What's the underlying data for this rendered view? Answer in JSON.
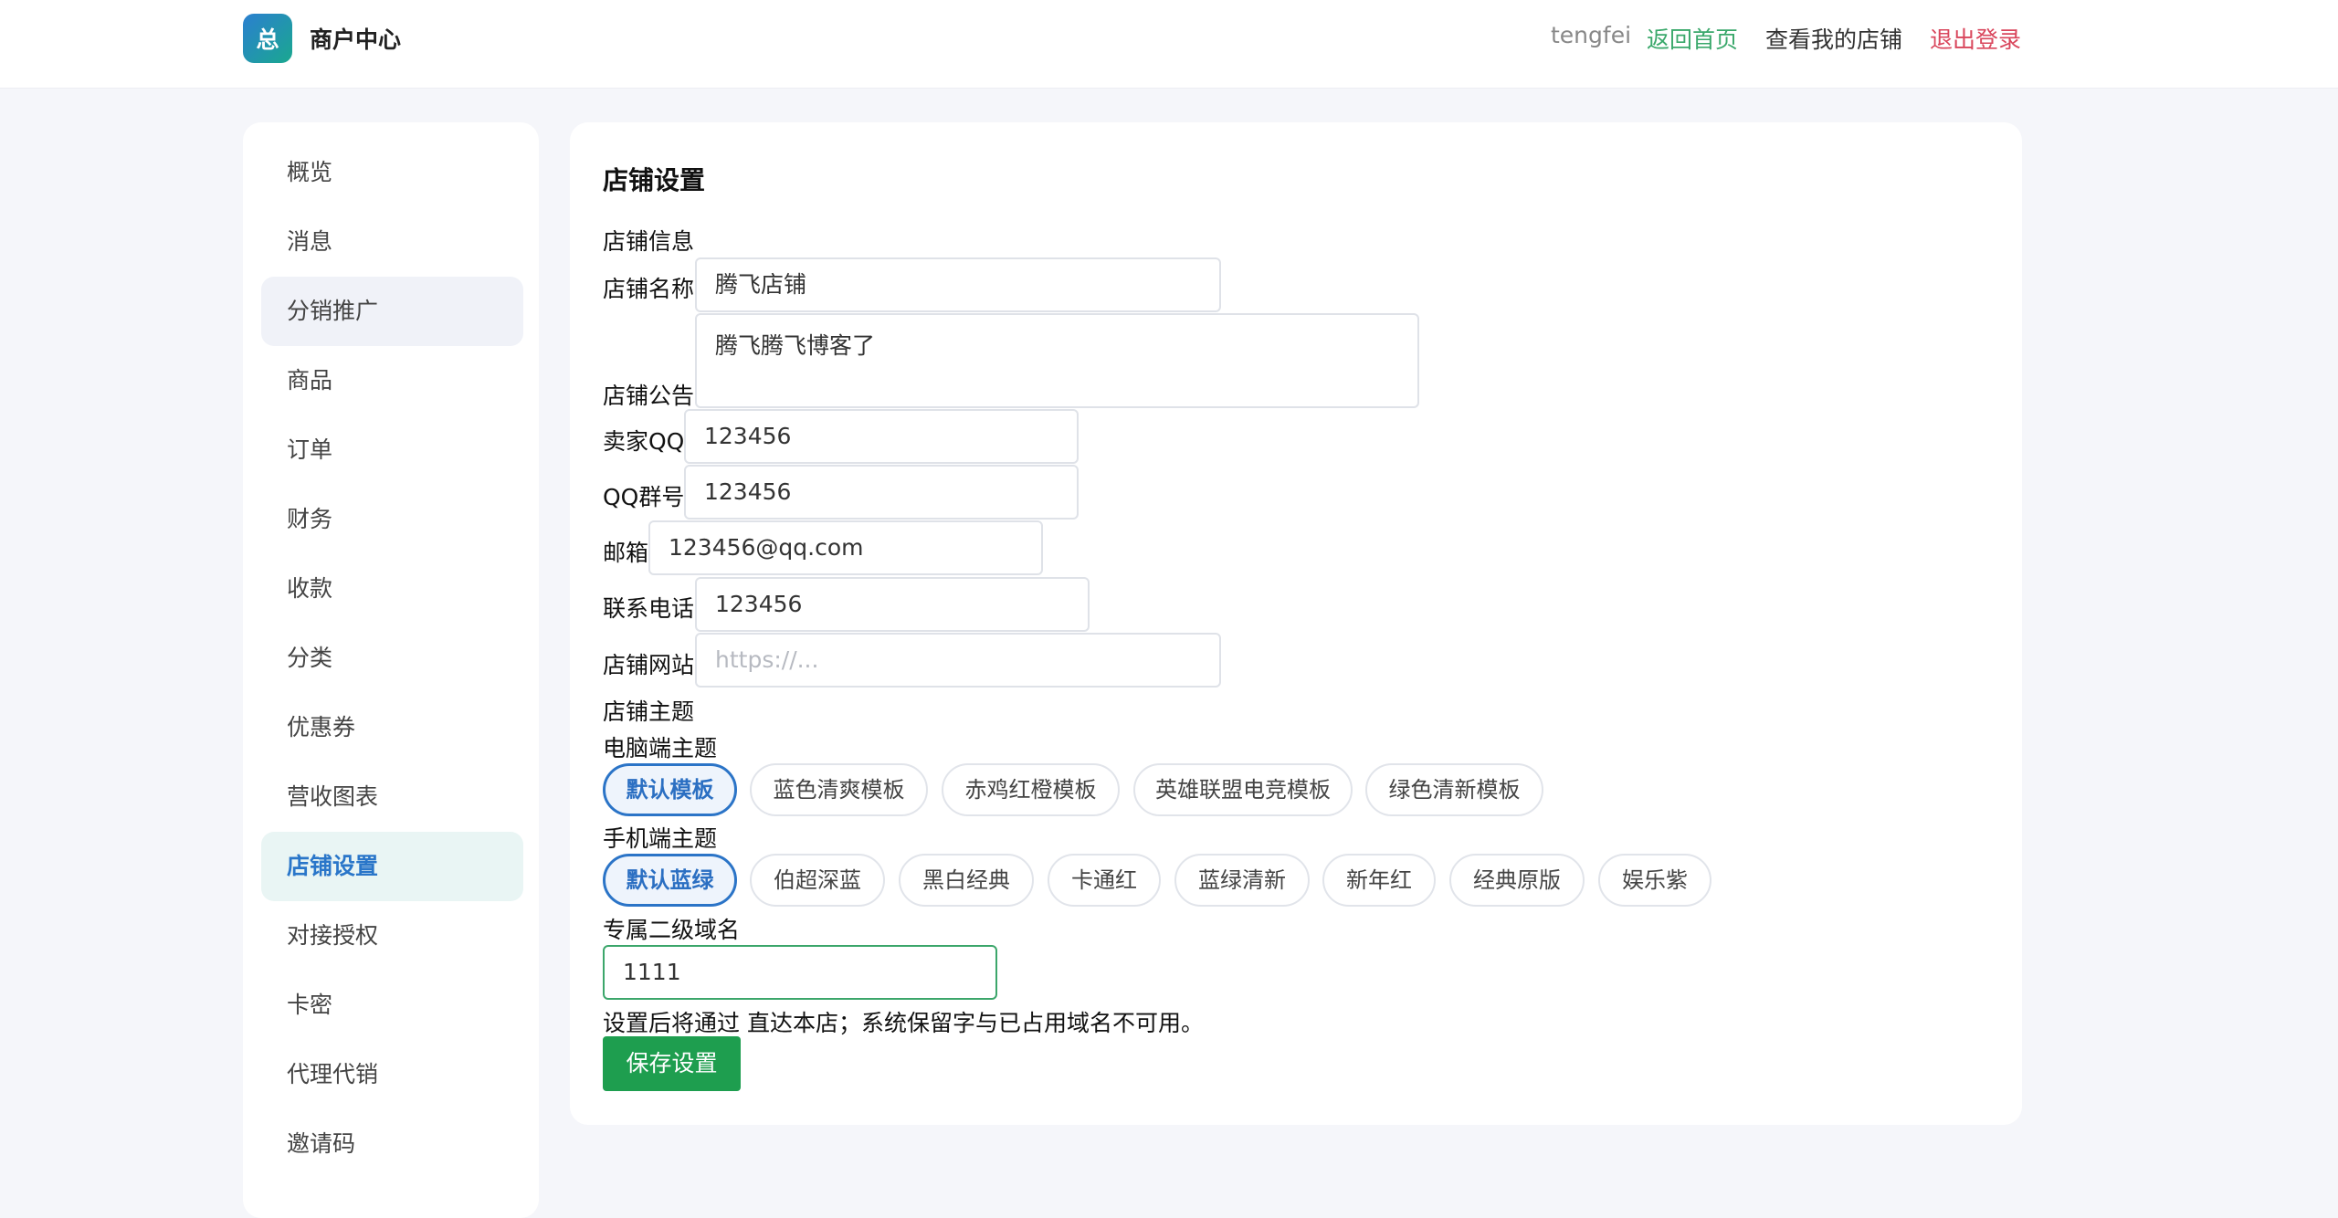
{
  "header": {
    "logo_char": "总",
    "title": "商户中心",
    "username": "tengfei",
    "home_link": "返回首页",
    "view_store_link": "查看我的店铺",
    "logout_link": "退出登录",
    "colors": {
      "home": "#3aa86b",
      "logout": "#d9465c",
      "brand": "#2b7fd0"
    }
  },
  "sidebar": {
    "items": [
      {
        "label": "概览"
      },
      {
        "label": "消息"
      },
      {
        "label": "分销推广"
      },
      {
        "label": "商品"
      },
      {
        "label": "订单"
      },
      {
        "label": "财务"
      },
      {
        "label": "收款"
      },
      {
        "label": "分类"
      },
      {
        "label": "优惠券"
      },
      {
        "label": "营收图表"
      },
      {
        "label": "店铺设置"
      },
      {
        "label": "对接授权"
      },
      {
        "label": "卡密"
      },
      {
        "label": "代理代销"
      },
      {
        "label": "邀请码"
      }
    ],
    "active": "店铺设置"
  },
  "main": {
    "title": "店铺设置",
    "section_info": "店铺信息",
    "fields": {
      "store_name": {
        "label": "店铺名称",
        "value": "腾飞店铺"
      },
      "announcement": {
        "label": "店铺公告",
        "value": "腾飞腾飞博客了"
      },
      "seller_qq": {
        "label": "卖家QQ",
        "value": "123456"
      },
      "qq_group": {
        "label": "QQ群号",
        "value": "123456"
      },
      "email": {
        "label": "邮箱",
        "value": "123456@qq.com"
      },
      "phone": {
        "label": "联系电话",
        "value": "123456"
      },
      "website": {
        "label": "店铺网站",
        "value": "",
        "placeholder": "https://..."
      }
    },
    "section_theme": "店铺主题",
    "pc_theme_label": "电脑端主题",
    "pc_themes": [
      "默认模板",
      "蓝色清爽模板",
      "赤鸡红橙模板",
      "英雄联盟电竞模板",
      "绿色清新模板"
    ],
    "pc_theme_selected": "默认模板",
    "mobile_theme_label": "手机端主题",
    "mobile_themes": [
      "默认蓝绿",
      "伯超深蓝",
      "黑白经典",
      "卡通红",
      "蓝绿清新",
      "新年红",
      "经典原版",
      "娱乐紫"
    ],
    "mobile_theme_selected": "默认蓝绿",
    "subdomain_label": "专属二级域名",
    "subdomain_value": "1111",
    "subdomain_hint": "设置后将通过 直达本店；系统保留字与已占用域名不可用。",
    "save_button": "保存设置"
  }
}
